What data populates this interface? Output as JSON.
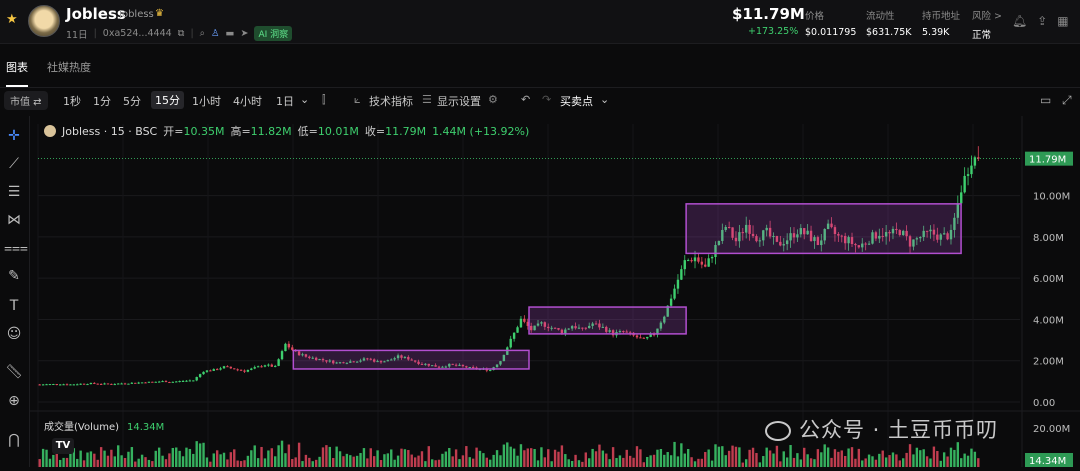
{
  "token": {
    "name": "Jobless",
    "symbol": "Jobless",
    "age": "11日",
    "address": "0xa524...4444",
    "ai_badge": "AI 洞察"
  },
  "price": {
    "value": "$11.79M",
    "change": "+173.25%"
  },
  "stats": [
    {
      "label": "价格",
      "value": "$0.011795"
    },
    {
      "label": "流动性",
      "value": "$631.75K"
    },
    {
      "label": "持币地址",
      "value": "5.39K"
    },
    {
      "label": "风险 >",
      "value": "正常"
    }
  ],
  "tabs": [
    "图表",
    "社媒热度"
  ],
  "toolbar": {
    "mcap": "市值 ⇄",
    "timeframes": [
      "1秒",
      "1分",
      "5分",
      "15分",
      "1小时",
      "4小时",
      "1日"
    ],
    "active_timeframe": "15分",
    "indicators": "技术指标",
    "display": "显示设置",
    "buysell": "买卖点"
  },
  "legend": {
    "title": "Jobless · 15 · BSC",
    "open_label": "开=",
    "open": "10.35M",
    "high_label": "高=",
    "high": "11.82M",
    "low_label": "低=",
    "low": "10.01M",
    "close_label": "收=",
    "close": "11.79M",
    "change": "1.44M (+13.92%)"
  },
  "volume": {
    "label": "成交量(Volume)",
    "value": "14.34M",
    "axis_top": "20.00M",
    "tag": "14.34M"
  },
  "watermark": "公众号 · 土豆币币叨",
  "colors": {
    "up": "#3ecf6e",
    "down": "#e0475c",
    "box": "#b24fd0",
    "bg": "#0b0b0c"
  },
  "chart_data": {
    "type": "candlestick",
    "title": "Jobless · 15 · BSC",
    "ylim": [
      0,
      12.5
    ],
    "y_ticks": [
      "10.00M",
      "8.00M",
      "6.00M",
      "4.00M",
      "2.00M",
      "0.00"
    ],
    "last_value_tag": "11.79M",
    "series_close_approx": [
      0.85,
      0.86,
      0.87,
      0.85,
      0.88,
      0.9,
      0.88,
      0.87,
      0.9,
      0.92,
      0.95,
      0.97,
      1.0,
      0.98,
      1.02,
      1.05,
      1.5,
      1.55,
      1.7,
      1.6,
      1.5,
      1.65,
      1.8,
      1.7,
      2.8,
      2.4,
      2.2,
      2.1,
      2.0,
      1.9,
      1.95,
      2.0,
      2.1,
      1.95,
      2.0,
      2.2,
      2.1,
      1.9,
      1.8,
      1.7,
      1.8,
      1.75,
      1.65,
      1.6,
      1.55,
      2.0,
      3.0,
      4.0,
      3.5,
      3.8,
      3.6,
      3.4,
      3.7,
      3.5,
      3.8,
      3.6,
      3.3,
      3.4,
      3.2,
      3.0,
      3.3,
      4.2,
      5.5,
      6.8,
      7.0,
      6.5,
      7.5,
      8.5,
      7.8,
      8.6,
      8.0,
      8.2,
      7.6,
      7.9,
      8.3,
      8.1,
      7.7,
      8.4,
      8.0,
      7.8,
      7.5,
      7.9,
      8.2,
      8.1,
      8.3,
      7.7,
      8.0,
      8.2,
      8.0,
      8.1,
      10.35,
      11.79
    ],
    "boxes": [
      {
        "x0_frac": 0.26,
        "x1_frac": 0.5,
        "low": 1.6,
        "high": 2.5
      },
      {
        "x0_frac": 0.5,
        "x1_frac": 0.66,
        "low": 3.3,
        "high": 4.6
      },
      {
        "x0_frac": 0.66,
        "x1_frac": 0.94,
        "low": 7.2,
        "high": 9.6
      }
    ]
  }
}
